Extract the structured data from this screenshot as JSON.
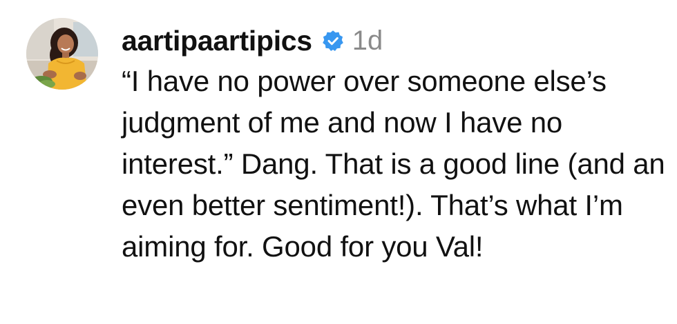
{
  "comment": {
    "username": "aartipaartipics",
    "verified_icon": "verified-badge-icon",
    "verified_color": "#3897f0",
    "timestamp": "1d",
    "text": "“I have no power over someone else’s judgment of me and now I have no interest.” Dang. That is a good line (and an even better sentiment!). That’s what I’m aiming for. Good for you Val!"
  },
  "colors": {
    "text": "#111111",
    "secondary_text": "#8a8a8a",
    "background": "#ffffff"
  }
}
